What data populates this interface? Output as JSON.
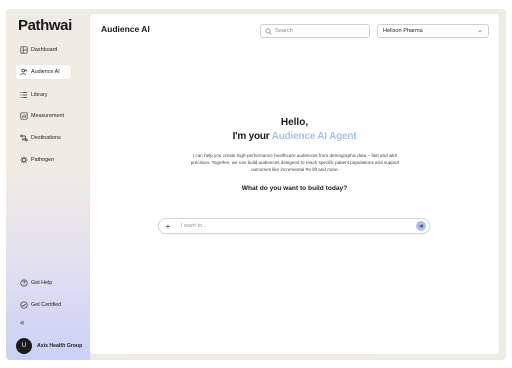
{
  "app": {
    "logo": "Pathwai"
  },
  "sidebar": {
    "items": [
      {
        "label": "Dashboard",
        "icon": "layout-icon",
        "active": false
      },
      {
        "label": "Audience AI",
        "icon": "audience-icon",
        "active": true
      },
      {
        "label": "Library",
        "icon": "list-icon",
        "active": false
      },
      {
        "label": "Measurement",
        "icon": "measurement-icon",
        "active": false
      },
      {
        "label": "Destinations",
        "icon": "destinations-icon",
        "active": false
      },
      {
        "label": "Pathogen",
        "icon": "gear-icon",
        "active": false
      }
    ],
    "bottom_items": [
      {
        "label": "Get Help",
        "icon": "help-icon"
      },
      {
        "label": "Get Certified",
        "icon": "check-circle-icon"
      }
    ],
    "collapse_glyph": "«",
    "user": {
      "initial": "U",
      "name": "Axis Health Group"
    }
  },
  "header": {
    "title": "Audience AI",
    "search": {
      "placeholder": "Search",
      "value": ""
    },
    "org_select": {
      "value": "Helixon Pharma"
    }
  },
  "main": {
    "greeting": "Hello,",
    "agent_prefix": "I'm your ",
    "agent_name": "Audience AI Agent",
    "description": "I can help you create high-performance healthcare audiences from demographic data – fast and with precision. Together, we can build audiences designed to reach specific patient populations and support outcomes like incremental Rx lift and more.",
    "question": "What do you want to build today?",
    "prompt": {
      "placeholder": "I want to...",
      "value": "",
      "plus": "+"
    }
  },
  "colors": {
    "accent": "#a9c0ef",
    "frame": "#efece3",
    "avatar": "#1c1c1c"
  }
}
